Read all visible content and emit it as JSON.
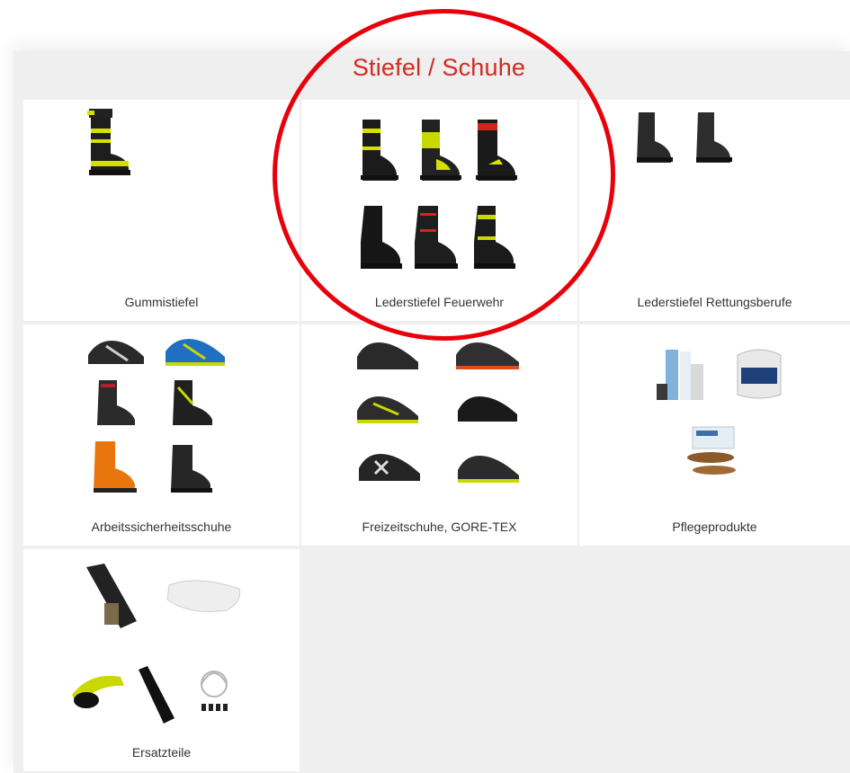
{
  "section": {
    "title": "Stiefel / Schuhe"
  },
  "categories": [
    {
      "label": "Gummistiefel"
    },
    {
      "label": "Lederstiefel Feuerwehr"
    },
    {
      "label": "Lederstiefel Rettungsberufe"
    },
    {
      "label": "Arbeitssicherheitsschuhe"
    },
    {
      "label": "Freizeitschuhe, GORE-TEX"
    },
    {
      "label": "Pflegeprodukte"
    },
    {
      "label": "Ersatzteile"
    }
  ],
  "colors": {
    "title": "#d32a20",
    "highlight_circle": "#e8000b",
    "panel_background": "#efefef",
    "accent_yellow": "#d5e000",
    "accent_blue": "#1f6fc4",
    "accent_orange": "#e9760c"
  }
}
